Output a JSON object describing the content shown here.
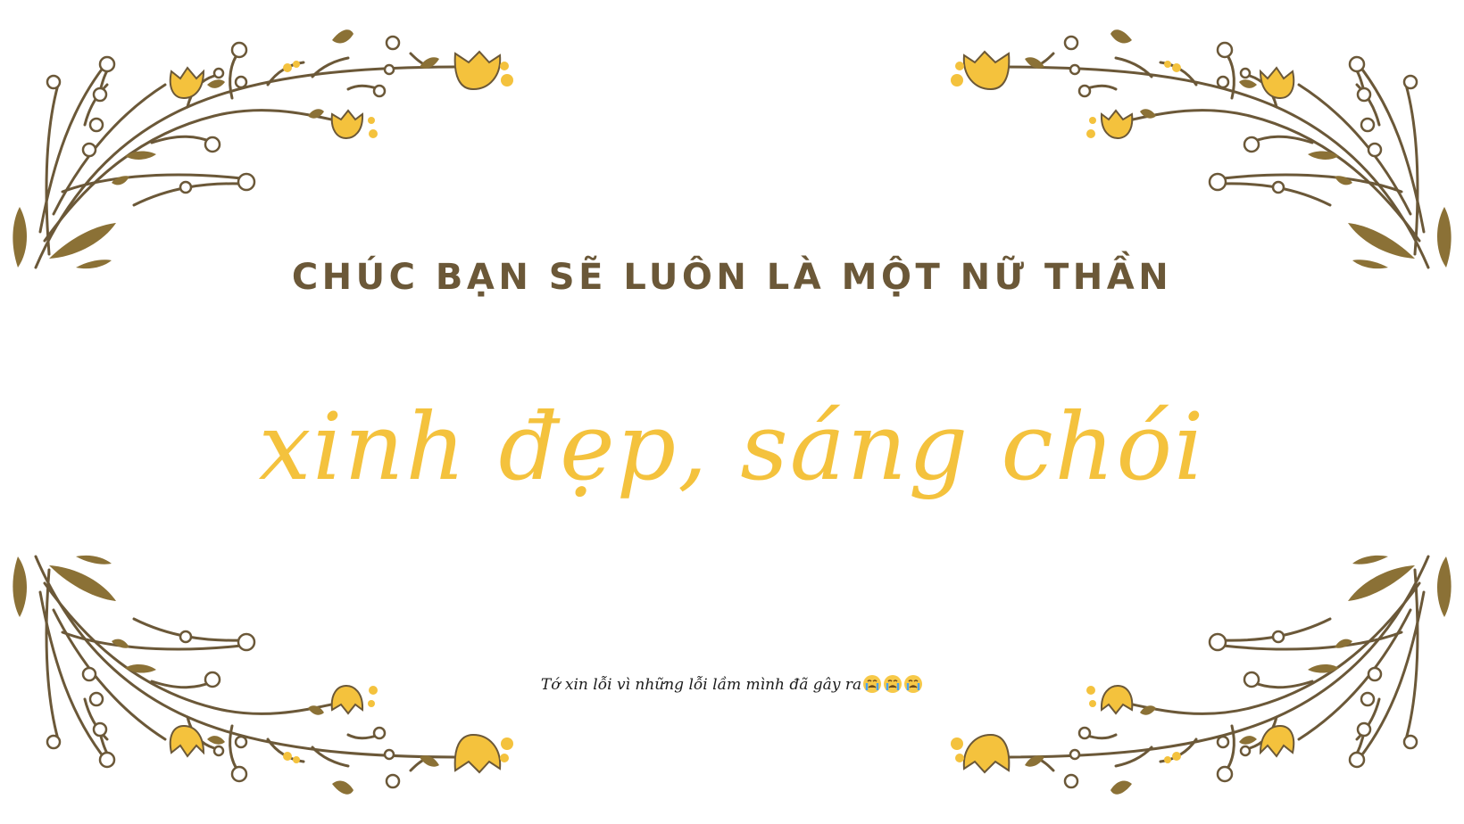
{
  "card": {
    "heading": "CHÚC BẠN SẼ LUÔN LÀ MỘT NỮ THẦN",
    "script_line": "xinh đẹp, sáng chói",
    "note": "Tớ xin lỗi vì những lỗi lầm mình đã gây ra"
  },
  "decor": {
    "icons": [
      "floral-wreath-corner-icon",
      "crying-face-icon"
    ],
    "colors": {
      "stem": "#6b5838",
      "leaf": "#8b7136",
      "flower": "#f4c23d",
      "heading": "#6b5838",
      "script": "#f4c23d"
    }
  }
}
